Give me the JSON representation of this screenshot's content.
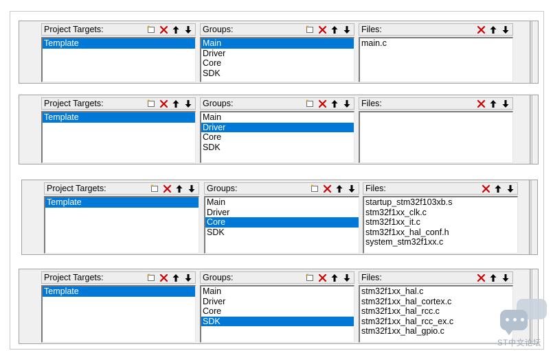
{
  "panels": [
    {
      "targets": {
        "label": "Project Targets:",
        "items": [
          "Template"
        ],
        "selected": 0
      },
      "groups": {
        "label": "Groups:",
        "items": [
          "Main",
          "Driver",
          "Core",
          "SDK"
        ],
        "selected": 0
      },
      "files": {
        "label": "Files:",
        "items": [
          "main.c"
        ],
        "selected": -1
      }
    },
    {
      "targets": {
        "label": "Project Targets:",
        "items": [
          "Template"
        ],
        "selected": 0
      },
      "groups": {
        "label": "Groups:",
        "items": [
          "Main",
          "Driver",
          "Core",
          "SDK"
        ],
        "selected": 1
      },
      "files": {
        "label": "Files:",
        "items": [],
        "selected": -1
      }
    },
    {
      "targets": {
        "label": "Project Targets:",
        "items": [
          "Template"
        ],
        "selected": 0
      },
      "groups": {
        "label": "Groups:",
        "items": [
          "Main",
          "Driver",
          "Core",
          "SDK"
        ],
        "selected": 2
      },
      "files": {
        "label": "Files:",
        "items": [
          "startup_stm32f103xb.s",
          "stm32f1xx_clk.c",
          "stm32f1xx_it.c",
          "stm32f1xx_hal_conf.h",
          "system_stm32f1xx.c"
        ],
        "selected": -1
      }
    },
    {
      "targets": {
        "label": "Project Targets:",
        "items": [
          "Template"
        ],
        "selected": 0
      },
      "groups": {
        "label": "Groups:",
        "items": [
          "Main",
          "Driver",
          "Core",
          "SDK"
        ],
        "selected": 3
      },
      "files": {
        "label": "Files:",
        "items": [
          "stm32f1xx_hal.c",
          "stm32f1xx_hal_cortex.c",
          "stm32f1xx_hal_rcc.c",
          "stm32f1xx_hal_rcc_ex.c",
          "stm32f1xx_hal_gpio.c"
        ],
        "selected": -1
      }
    }
  ],
  "icons": {
    "new": "new-item-icon",
    "delete": "delete-icon",
    "up": "move-up-icon",
    "down": "move-down-icon"
  },
  "colors": {
    "selection": "#0078d7",
    "delete": "#d00000",
    "panel": "#f0f0f0"
  },
  "watermark": {
    "text": "ST中文论坛"
  }
}
